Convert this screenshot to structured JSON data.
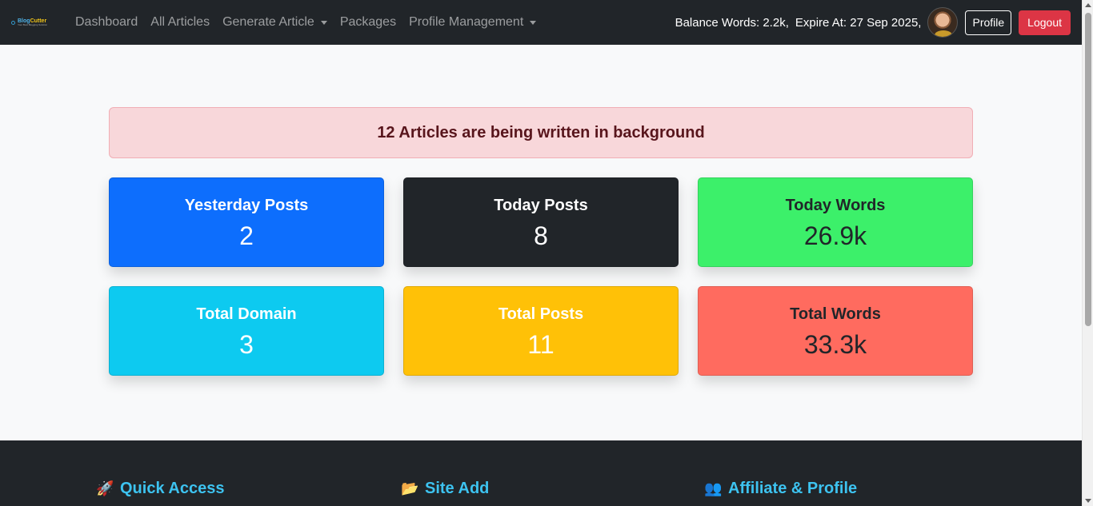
{
  "navbar": {
    "brand": {
      "name_part1": "Blog",
      "name_part2": "Cutter",
      "tagline": "Your Best Blogging Solution"
    },
    "links": [
      {
        "label": "Dashboard",
        "dropdown": false
      },
      {
        "label": "All Articles",
        "dropdown": false
      },
      {
        "label": "Generate Article",
        "dropdown": true
      },
      {
        "label": "Packages",
        "dropdown": false
      },
      {
        "label": "Profile Management",
        "dropdown": true
      }
    ],
    "balance_text": "Balance Words: 2.2k,",
    "expire_text": "Expire At: 27 Sep 2025,",
    "profile_button": "Profile",
    "logout_button": "Logout"
  },
  "alert": {
    "text": "12 Articles are being written in background"
  },
  "stats": [
    {
      "title": "Yesterday Posts",
      "value": "2",
      "color": "#0d6efd"
    },
    {
      "title": "Today Posts",
      "value": "8",
      "color": "#212529"
    },
    {
      "title": "Today Words",
      "value": "26.9k",
      "color": "#3cf06a"
    },
    {
      "title": "Total Domain",
      "value": "3",
      "color": "#0dcaf0"
    },
    {
      "title": "Total Posts",
      "value": "11",
      "color": "#ffc107"
    },
    {
      "title": "Total Words",
      "value": "33.3k",
      "color": "#ff6b5f"
    }
  ],
  "footer": {
    "sections": [
      {
        "title": "Quick Access",
        "icon": "rocket-icon",
        "glyph": "🚀"
      },
      {
        "title": "Site Add",
        "icon": "folder-icon",
        "glyph": "📂"
      },
      {
        "title": "Affiliate & Profile",
        "icon": "users-icon",
        "glyph": "👥"
      }
    ]
  }
}
